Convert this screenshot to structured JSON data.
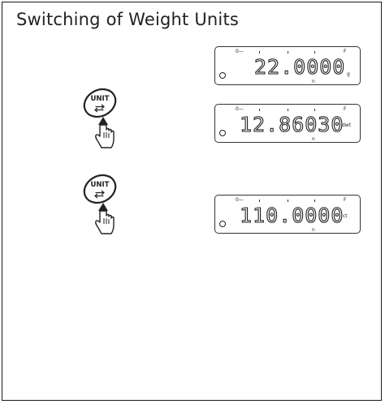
{
  "title": "Switching of Weight Units",
  "unit_key": {
    "label": "UNIT"
  },
  "display_marks": {
    "zero": "0",
    "full": "F",
    "stable": "n"
  },
  "displays": [
    {
      "value": "22.0000",
      "unit": "g"
    },
    {
      "value": "12.86030",
      "unit": "dwt"
    },
    {
      "value": "110.0000",
      "unit": "ct"
    }
  ],
  "icons": [
    "unit-key-icon",
    "pressing-hand-icon",
    "cycle-arrows-icon"
  ],
  "colors": {
    "ink": "#222222",
    "background": "#ffffff"
  }
}
